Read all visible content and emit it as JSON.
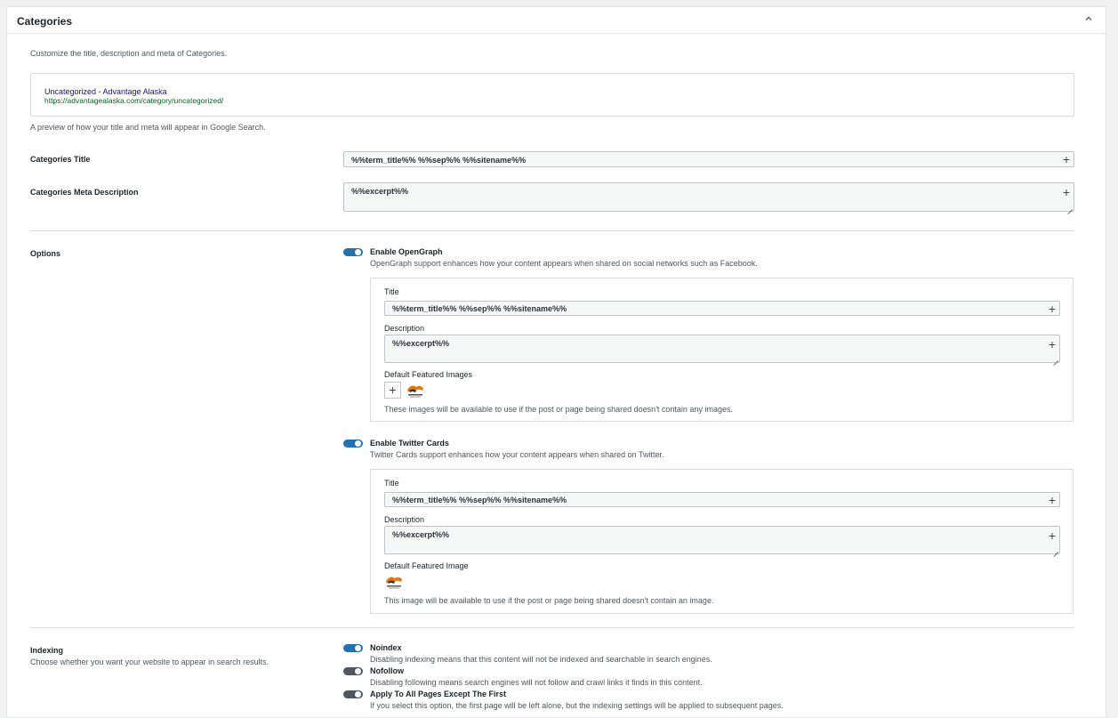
{
  "panel": {
    "title": "Categories"
  },
  "intro": "Customize the title, description and meta of Categories.",
  "preview": {
    "title": "Uncategorized - Advantage Alaska",
    "url": "https://advantagealaska.com/category/uncategorized/",
    "caption": "A preview of how your title and meta will appear in Google Search."
  },
  "fields": {
    "title_label": "Categories Title",
    "title_value": "%%term_title%% %%sep%% %%sitename%%",
    "desc_label": "Categories Meta Description",
    "desc_value": "%%excerpt%%"
  },
  "options": {
    "label": "Options",
    "opengraph": {
      "label": "Enable OpenGraph",
      "enabled": true,
      "help": "OpenGraph support enhances how your content appears when shared on social networks such as Facebook.",
      "title_label": "Title",
      "title_value": "%%term_title%% %%sep%% %%sitename%%",
      "desc_label": "Description",
      "desc_value": "%%excerpt%%",
      "images_label": "Default Featured Images",
      "images_help": "These images will be available to use if the post or page being shared doesn't contain any images."
    },
    "twitter": {
      "label": "Enable Twitter Cards",
      "enabled": true,
      "help": "Twitter Cards support enhances how your content appears when shared on Twitter.",
      "title_label": "Title",
      "title_value": "%%term_title%% %%sep%% %%sitename%%",
      "desc_label": "Description",
      "desc_value": "%%excerpt%%",
      "image_label": "Default Featured Image",
      "image_help": "This image will be available to use if the post or page being shared doesn't contain an image."
    }
  },
  "indexing": {
    "label": "Indexing",
    "help": "Choose whether you want your website to appear in search results.",
    "items": [
      {
        "label": "Noindex",
        "enabled": true,
        "help": "Disabling indexing means that this content will not be indexed and searchable in search engines."
      },
      {
        "label": "Nofollow",
        "enabled": false,
        "help": "Disabling following means search engines will not follow and crawl links it finds in this content."
      },
      {
        "label": "Apply To All Pages Except The First",
        "enabled": false,
        "help": "If you select this option, the first page will be left alone, but the indexing settings will be applied to subsequent pages."
      }
    ]
  },
  "icons": {
    "collapse": "chevron-up-icon",
    "add": "plus-icon",
    "resize": "resize-grip-icon",
    "image": "featured-image-thumbnail"
  },
  "colors": {
    "accent": "#2271b1",
    "link_title": "#1a0dab",
    "link_url": "#006621",
    "toggle_off": "#50575e"
  }
}
